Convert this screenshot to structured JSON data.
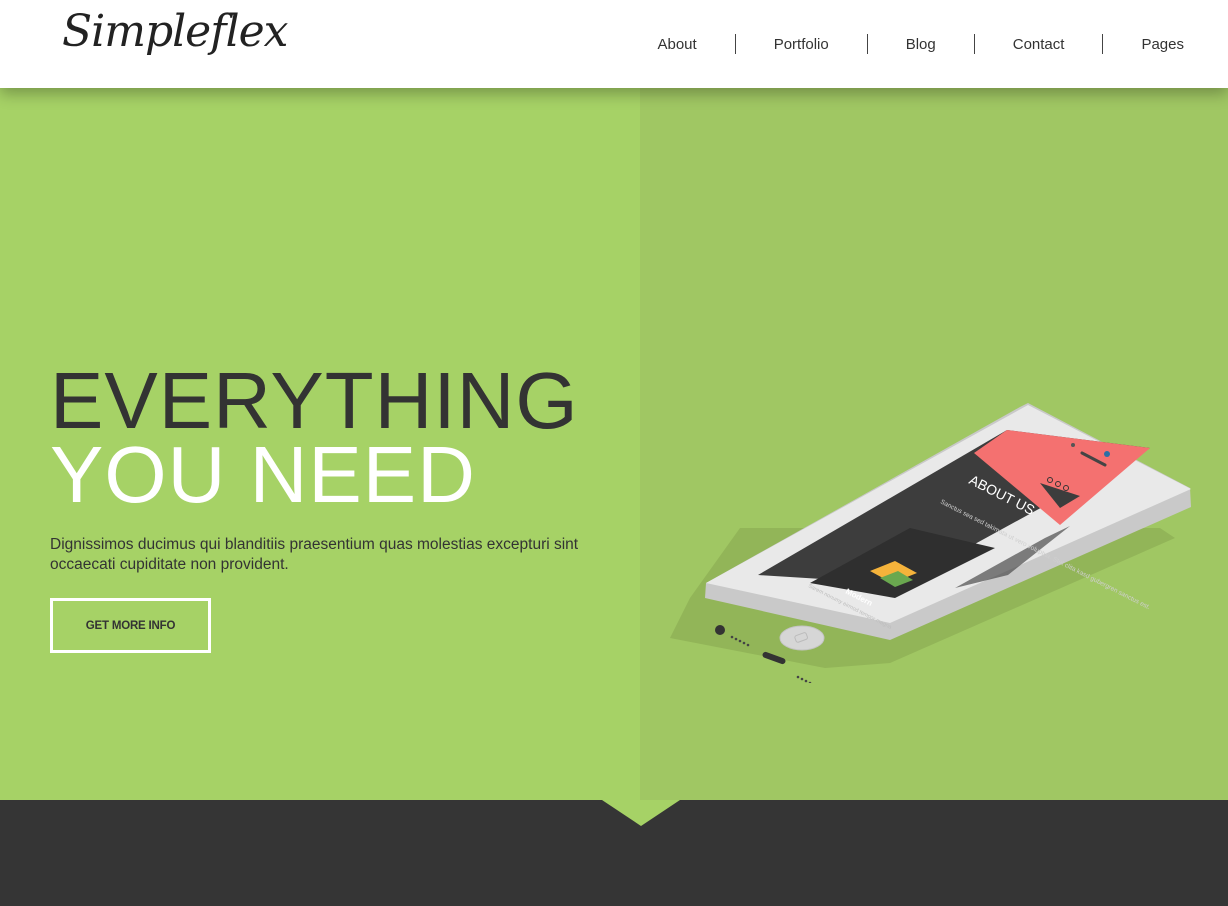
{
  "header": {
    "logo_text": "Simpleflex",
    "nav": [
      {
        "label": "About"
      },
      {
        "label": "Portfolio"
      },
      {
        "label": "Blog"
      },
      {
        "label": "Contact"
      },
      {
        "label": "Pages"
      }
    ]
  },
  "hero": {
    "headline_line1": "EVERYTHING",
    "headline_line2": "YOU NEED",
    "subtitle": "Dignissimos ducimus qui blanditiis praesentium quas molestias excepturi sint occaecati cupiditate non provident.",
    "cta_label": "GET MORE INFO",
    "phone_screen": {
      "heading": "ABOUT US",
      "text": "Sanctus sea sed takimata ut vero voluptua. Stet clita kasd gubergren sanctus est.",
      "brand": "Modern",
      "brand_text": "Sarem nonumy eirmod tempor magna"
    }
  },
  "colors": {
    "hero_green": "#a6d266",
    "hero_green_dark": "#a0c763",
    "dark": "#353535",
    "phone_accent": "#f47170"
  }
}
